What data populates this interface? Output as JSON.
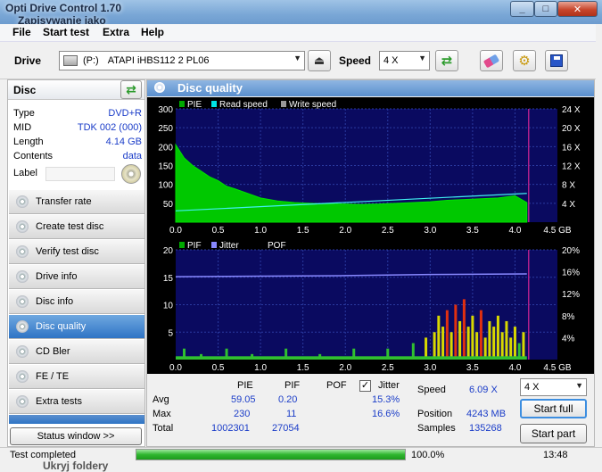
{
  "window": {
    "title": "Opti Drive Control 1.70",
    "subtitle": "Zapisywanie jako",
    "min_glyph": "_",
    "max_glyph": "□",
    "close_glyph": "✕"
  },
  "menu": [
    "File",
    "Start test",
    "Extra",
    "Help"
  ],
  "drivebar": {
    "drive_label": "Drive",
    "drive_letter": "(P:)",
    "drive_name": "ATAPI iHBS112   2 PL06",
    "speed_label": "Speed",
    "speed_value": "4 X"
  },
  "disc": {
    "header": "Disc",
    "rows": [
      {
        "key": "Type",
        "value": "DVD+R"
      },
      {
        "key": "MID",
        "value": "TDK 002 (000)"
      },
      {
        "key": "Length",
        "value": "4.14 GB"
      },
      {
        "key": "Contents",
        "value": "data"
      }
    ],
    "label_key": "Label",
    "label_value": ""
  },
  "nav": [
    {
      "label": "Transfer rate",
      "active": false
    },
    {
      "label": "Create test disc",
      "active": false
    },
    {
      "label": "Verify test disc",
      "active": false
    },
    {
      "label": "Drive info",
      "active": false
    },
    {
      "label": "Disc info",
      "active": false
    },
    {
      "label": "Disc quality",
      "active": true
    },
    {
      "label": "CD Bler",
      "active": false
    },
    {
      "label": "FE / TE",
      "active": false
    },
    {
      "label": "Extra tests",
      "active": false
    }
  ],
  "status_window_button": "Status window >>",
  "main_title": "Disc quality",
  "chart_data": [
    {
      "type": "area",
      "legend": [
        "PIE",
        "Read speed",
        "Write speed"
      ],
      "legend_colors": [
        "#00aa00",
        "#00e5e5",
        "#999999"
      ],
      "x_ticks": [
        "0.0",
        "0.5",
        "1.0",
        "1.5",
        "2.0",
        "2.5",
        "3.0",
        "3.5",
        "4.0",
        "4.5 GB"
      ],
      "xlim": [
        0,
        4.5
      ],
      "y_ticks": [
        "50",
        "100",
        "150",
        "200",
        "250",
        "300"
      ],
      "ylim": [
        0,
        300
      ],
      "y2_ticks": [
        "4 X",
        "8 X",
        "12 X",
        "16 X",
        "20 X",
        "24 X"
      ],
      "y2lim": [
        0,
        24
      ],
      "pie": {
        "x": [
          0.0,
          0.1,
          0.2,
          0.3,
          0.4,
          0.5,
          0.6,
          0.7,
          0.8,
          0.9,
          1.0,
          1.2,
          1.4,
          1.6,
          1.8,
          2.0,
          2.2,
          2.4,
          2.6,
          2.8,
          3.0,
          3.2,
          3.4,
          3.6,
          3.8,
          4.0,
          4.14
        ],
        "y": [
          205,
          170,
          150,
          135,
          120,
          110,
          95,
          88,
          80,
          72,
          64,
          56,
          52,
          50,
          48,
          48,
          47,
          48,
          50,
          52,
          54,
          58,
          60,
          62,
          64,
          70,
          52
        ]
      },
      "read_speed": {
        "x": [
          0.0,
          4.14
        ],
        "y": [
          2.4,
          6.09
        ]
      },
      "end_marker_x": 4.14
    },
    {
      "type": "bar",
      "legend": [
        "PIF",
        "Jitter",
        "POF"
      ],
      "legend_colors": [
        "#00aa00",
        "#8888ff",
        "#000000"
      ],
      "x_ticks": [
        "0.0",
        "0.5",
        "1.0",
        "1.5",
        "2.0",
        "2.5",
        "3.0",
        "3.5",
        "4.0",
        "4.5 GB"
      ],
      "xlim": [
        0,
        4.5
      ],
      "y_ticks": [
        "5",
        "10",
        "15",
        "20"
      ],
      "ylim": [
        0,
        20
      ],
      "y2_ticks": [
        "4%",
        "8%",
        "12%",
        "16%",
        "20%"
      ],
      "y2lim": [
        0,
        20
      ],
      "pif_peaks": {
        "x": [
          0.1,
          0.3,
          0.6,
          0.9,
          1.3,
          1.7,
          2.1,
          2.5,
          2.8,
          2.95,
          3.05,
          3.1,
          3.15,
          3.2,
          3.25,
          3.3,
          3.35,
          3.4,
          3.45,
          3.5,
          3.55,
          3.6,
          3.65,
          3.7,
          3.75,
          3.8,
          3.85,
          3.9,
          3.95,
          4.0,
          4.05,
          4.1
        ],
        "y": [
          2,
          1,
          2,
          1,
          2,
          1,
          2,
          2,
          3,
          4,
          5,
          8,
          6,
          9,
          5,
          10,
          7,
          11,
          6,
          8,
          5,
          9,
          4,
          7,
          6,
          8,
          5,
          7,
          4,
          6,
          3,
          5
        ]
      },
      "jitter": {
        "x": [
          0.0,
          1.0,
          2.0,
          3.0,
          4.14
        ],
        "y": [
          15.1,
          15.2,
          15.3,
          15.5,
          15.6
        ]
      },
      "end_marker_x": 4.14
    }
  ],
  "stats": {
    "headers": [
      "PIE",
      "PIF",
      "POF",
      "Jitter"
    ],
    "jitter_checked": true,
    "rows": [
      {
        "label": "Avg",
        "pie": "59.05",
        "pif": "0.20",
        "pof": "",
        "jitter": "15.3%"
      },
      {
        "label": "Max",
        "pie": "230",
        "pif": "11",
        "pof": "",
        "jitter": "16.6%"
      },
      {
        "label": "Total",
        "pie": "1002301",
        "pif": "27054",
        "pof": "",
        "jitter": ""
      }
    ],
    "speed_label": "Speed",
    "speed_value": "6.09 X",
    "position_label": "Position",
    "position_value": "4243 MB",
    "samples_label": "Samples",
    "samples_value": "135268",
    "speed_select": "4 X",
    "start_full": "Start full",
    "start_part": "Start part"
  },
  "statusbar": {
    "text": "Test completed",
    "progress": 100,
    "progress_text": "100.0%",
    "time": "13:48",
    "behind_text": "Ukryj foldery"
  }
}
